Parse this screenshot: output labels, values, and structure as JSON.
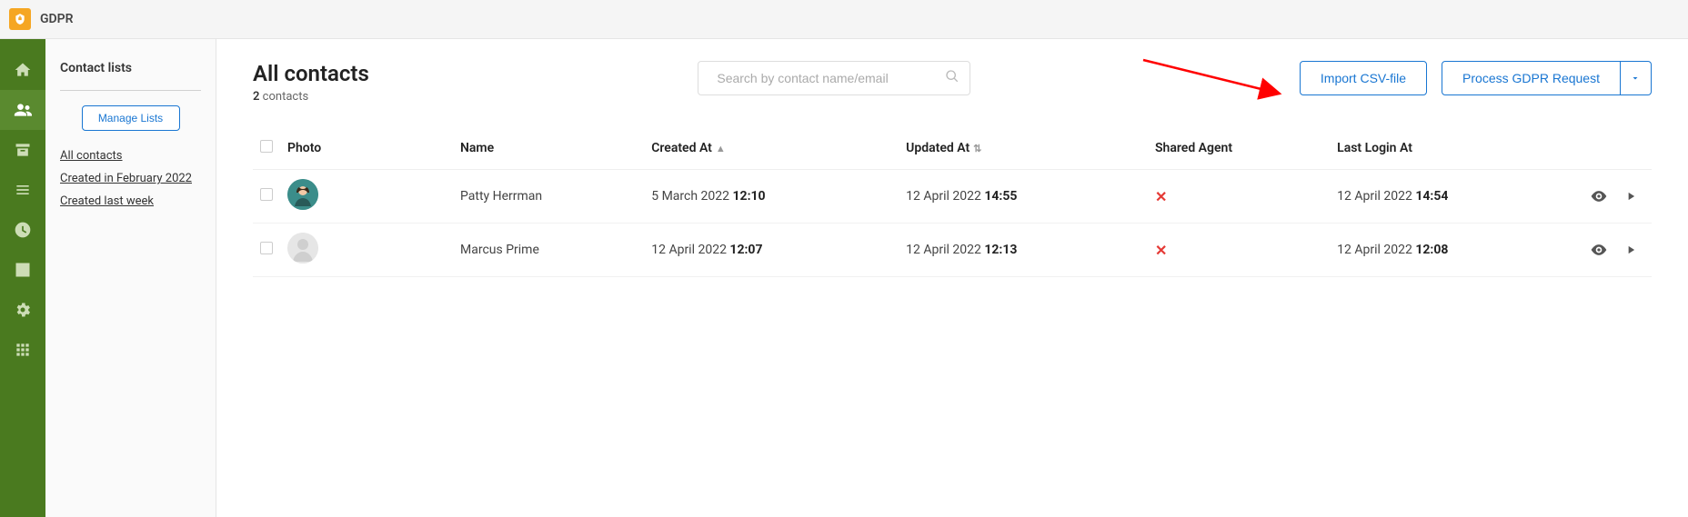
{
  "app": {
    "title": "GDPR"
  },
  "sidebar": {
    "title": "Contact lists",
    "manage_label": "Manage Lists",
    "links": [
      {
        "label": "All contacts"
      },
      {
        "label": "Created in February 2022"
      },
      {
        "label": "Created last week"
      }
    ]
  },
  "nav_icons": [
    "home",
    "users",
    "archive",
    "list",
    "clock",
    "chart",
    "gear",
    "apps"
  ],
  "header": {
    "title": "All contacts",
    "count": "2",
    "count_suffix": "contacts",
    "search_placeholder": "Search by contact name/email",
    "import_label": "Import CSV-file",
    "process_label": "Process GDPR Request"
  },
  "table": {
    "columns": {
      "photo": "Photo",
      "name": "Name",
      "created": "Created At",
      "updated": "Updated At",
      "shared": "Shared Agent",
      "lastlogin": "Last Login At"
    },
    "rows": [
      {
        "name": "Patty Herrman",
        "created_date": "5 March 2022",
        "created_time": "12:10",
        "updated_date": "12 April 2022",
        "updated_time": "14:55",
        "shared": false,
        "lastlogin_date": "12 April 2022",
        "lastlogin_time": "14:54",
        "avatar": "teal"
      },
      {
        "name": "Marcus Prime",
        "created_date": "12 April 2022",
        "created_time": "12:07",
        "updated_date": "12 April 2022",
        "updated_time": "12:13",
        "shared": false,
        "lastlogin_date": "12 April 2022",
        "lastlogin_time": "12:08",
        "avatar": "generic"
      }
    ]
  }
}
